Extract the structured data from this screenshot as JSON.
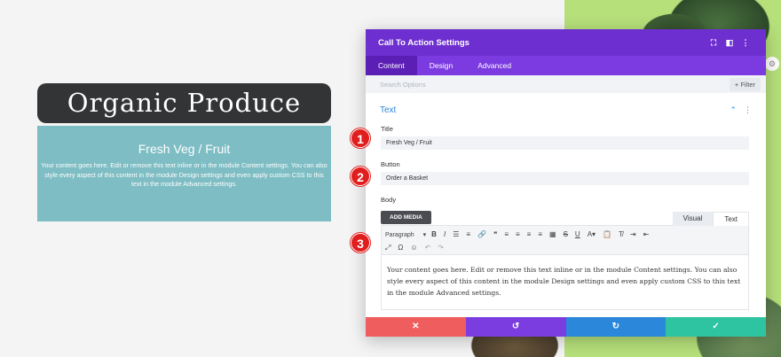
{
  "preview": {
    "title": "Organic Produce",
    "heading": "Fresh Veg / Fruit",
    "body": "Your content goes here. Edit or remove this text inline or in the module Content settings. You can also style every aspect of this content in the module Design settings and even apply custom CSS to this text in the module Advanced settings."
  },
  "modal": {
    "title": "Call To Action Settings",
    "tabs": [
      "Content",
      "Design",
      "Advanced"
    ],
    "search_placeholder": "Search Options",
    "filter_label": "+ Filter",
    "section_title": "Text",
    "fields": {
      "title_label": "Title",
      "title_value": "Fresh Veg / Fruit",
      "button_label": "Button",
      "button_value": "Order a Basket",
      "body_label": "Body"
    },
    "add_media": "ADD MEDIA",
    "editor_tabs": [
      "Visual",
      "Text"
    ],
    "paragraph_select": "Paragraph",
    "editor_content": "Your content goes here. Edit or remove this text inline or in the module Content settings. You can also style every aspect of this content in the module Design settings and even apply custom CSS to this text in the module Advanced settings."
  },
  "markers": [
    "1",
    "2",
    "3"
  ],
  "colors": {
    "header_purple": "#6d2fcf",
    "cancel": "#ef5d5f",
    "undo": "#7c3de0",
    "redo": "#2b87da",
    "save": "#2ec4a2",
    "marker_red": "#e01e1e"
  }
}
